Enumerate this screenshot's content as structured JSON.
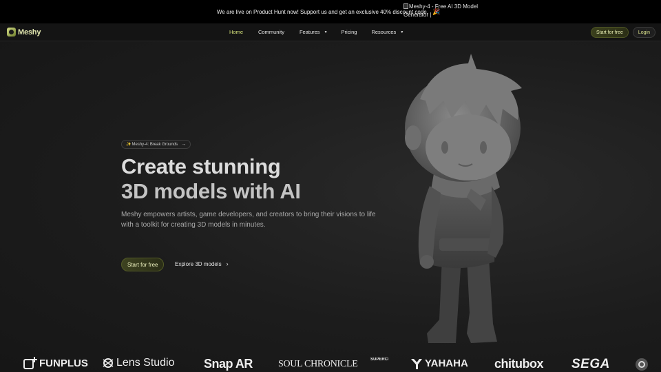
{
  "announcement": {
    "text": "We are live on Product Hunt now! Support us and get an exclusive 40% discount code.",
    "emoji": "🎉",
    "image_alt": "Meshy-4 - Free AI 3D Model Generator |"
  },
  "nav": {
    "logo_text": "Meshy",
    "items": [
      {
        "label": "Home",
        "active": true
      },
      {
        "label": "Community"
      },
      {
        "label": "Features",
        "caret": true
      },
      {
        "label": "Pricing"
      },
      {
        "label": "Resources",
        "caret": true
      }
    ],
    "start_label": "Start for free",
    "login_label": "Login"
  },
  "hero": {
    "badge_label": "Meshy-4: Break Grounds",
    "badge_icon": "sparkle-icon",
    "title_line1": "Create stunning",
    "title_line2": "3D models with AI",
    "subtitle": "Meshy empowers artists, game developers, and creators to bring their visions to life with a toolkit for creating 3D models in minutes.",
    "primary_cta": "Start for free",
    "secondary_cta": "Explore 3D models"
  },
  "partners": [
    "FUNPLUS",
    "Lens Studio",
    "Snap AR",
    "SOUL CHRONICLE",
    "SUPERCELL",
    "YAHAHA",
    "chitubox",
    "SEGA"
  ],
  "colors": {
    "accent": "#d4e07a",
    "background": "#1a1a1a",
    "announcement_bg": "#000000"
  }
}
